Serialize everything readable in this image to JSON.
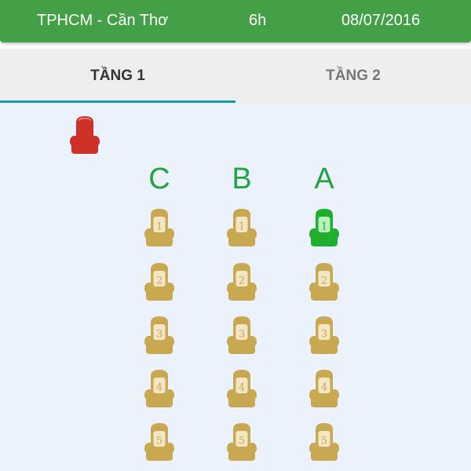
{
  "header": {
    "route": "TPHCM - Cần Thơ",
    "duration": "6h",
    "date": "08/07/2016"
  },
  "tabs": [
    {
      "label": "TẦNG 1",
      "active": true
    },
    {
      "label": "TẦNG 2",
      "active": false
    }
  ],
  "deck": {
    "driver_seat": {
      "icon": "seat-icon",
      "color": "#cc3026"
    },
    "columns": [
      "C",
      "B",
      "A"
    ],
    "row_numbers": [
      "1",
      "2",
      "3",
      "4",
      "5"
    ],
    "seats": [
      {
        "column": "C",
        "number": "1",
        "status": "available"
      },
      {
        "column": "B",
        "number": "1",
        "status": "available"
      },
      {
        "column": "A",
        "number": "1",
        "status": "selected"
      },
      {
        "column": "C",
        "number": "2",
        "status": "available"
      },
      {
        "column": "B",
        "number": "2",
        "status": "available"
      },
      {
        "column": "A",
        "number": "2",
        "status": "available"
      },
      {
        "column": "C",
        "number": "3",
        "status": "available"
      },
      {
        "column": "B",
        "number": "3",
        "status": "available"
      },
      {
        "column": "A",
        "number": "3",
        "status": "available"
      },
      {
        "column": "C",
        "number": "4",
        "status": "available"
      },
      {
        "column": "B",
        "number": "4",
        "status": "available"
      },
      {
        "column": "A",
        "number": "4",
        "status": "available"
      },
      {
        "column": "C",
        "number": "5",
        "status": "available"
      },
      {
        "column": "B",
        "number": "5",
        "status": "available"
      },
      {
        "column": "A",
        "number": "5",
        "status": "available"
      }
    ]
  },
  "colors": {
    "header_bg": "#43a047",
    "tab_indicator": "#1a9aa0",
    "column_label": "#21a444",
    "seat_available": "#c8a850",
    "seat_selected": "#1fae2e",
    "driver_seat": "#cc3026",
    "content_bg": "#ecf2fb"
  }
}
